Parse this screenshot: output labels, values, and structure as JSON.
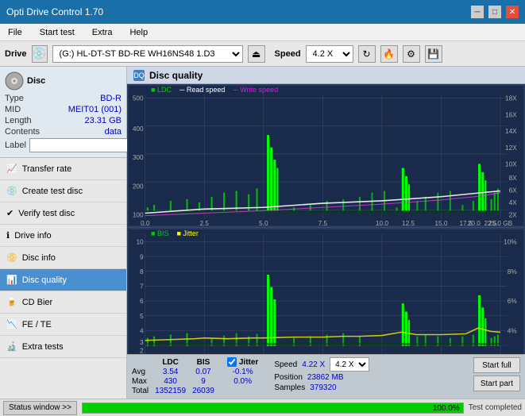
{
  "titlebar": {
    "title": "Opti Drive Control 1.70",
    "min_btn": "─",
    "max_btn": "□",
    "close_btn": "✕"
  },
  "menubar": {
    "items": [
      "File",
      "Start test",
      "Extra",
      "Help"
    ]
  },
  "drivebar": {
    "label": "Drive",
    "drive_value": "(G:) HL-DT-ST BD-RE  WH16NS48 1.D3",
    "speed_label": "Speed",
    "speed_value": "4.2 X"
  },
  "disc": {
    "type_label": "Type",
    "type_value": "BD-R",
    "mid_label": "MID",
    "mid_value": "MEIT01 (001)",
    "length_label": "Length",
    "length_value": "23.31 GB",
    "contents_label": "Contents",
    "contents_value": "data",
    "label_label": "Label",
    "label_value": ""
  },
  "nav": {
    "items": [
      {
        "id": "transfer-rate",
        "label": "Transfer rate",
        "icon": "chart-icon"
      },
      {
        "id": "create-test-disc",
        "label": "Create test disc",
        "icon": "disc-icon"
      },
      {
        "id": "verify-test-disc",
        "label": "Verify test disc",
        "icon": "check-icon"
      },
      {
        "id": "drive-info",
        "label": "Drive info",
        "icon": "info-icon"
      },
      {
        "id": "disc-info",
        "label": "Disc info",
        "icon": "disc-info-icon"
      },
      {
        "id": "disc-quality",
        "label": "Disc quality",
        "icon": "quality-icon",
        "active": true
      },
      {
        "id": "cd-bier",
        "label": "CD Bier",
        "icon": "beer-icon"
      },
      {
        "id": "fe-te",
        "label": "FE / TE",
        "icon": "graph-icon"
      },
      {
        "id": "extra-tests",
        "label": "Extra tests",
        "icon": "extra-icon"
      }
    ]
  },
  "disc_quality": {
    "title": "Disc quality",
    "legend": {
      "ldc": "LDC",
      "read_speed": "Read speed",
      "write_speed": "Write speed",
      "bis": "BIS",
      "jitter": "Jitter"
    }
  },
  "stats": {
    "headers": [
      "",
      "LDC",
      "BIS",
      "",
      "Jitter",
      "Speed",
      ""
    ],
    "avg_label": "Avg",
    "avg_ldc": "3.54",
    "avg_bis": "0.07",
    "avg_jitter": "-0.1%",
    "max_label": "Max",
    "max_ldc": "430",
    "max_bis": "9",
    "max_jitter": "0.0%",
    "total_label": "Total",
    "total_ldc": "1352159",
    "total_bis": "26039",
    "speed_label": "Speed",
    "speed_value": "4.22 X",
    "speed_select": "4.2 X",
    "position_label": "Position",
    "position_value": "23862 MB",
    "samples_label": "Samples",
    "samples_value": "379320",
    "start_full_label": "Start full",
    "start_part_label": "Start part"
  },
  "statusbar": {
    "status_btn_label": "Status window >>",
    "progress_value": 100,
    "progress_text": "100.0%",
    "status_text": "Test completed"
  }
}
